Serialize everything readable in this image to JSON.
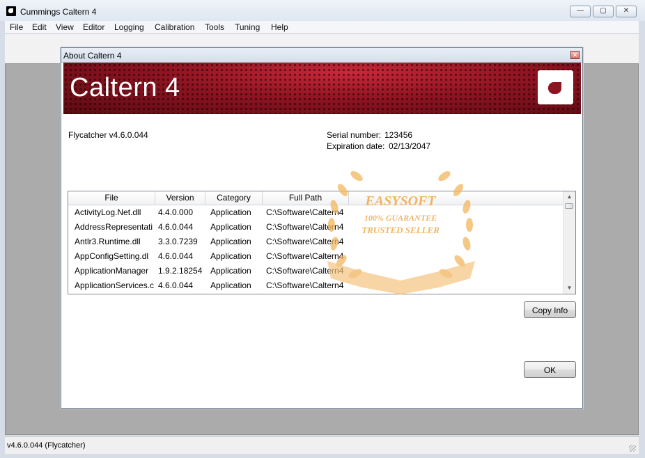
{
  "window": {
    "title": "Cummings Caltern 4",
    "minimize_glyph": "—",
    "maximize_glyph": "▢",
    "close_glyph": "✕"
  },
  "menu": [
    "File",
    "Edit",
    "View",
    "Editor",
    "Logging",
    "Calibration",
    "Tools",
    "Tuning",
    "Help"
  ],
  "dialog": {
    "title": "About Caltern 4",
    "close_glyph": "✕",
    "banner_title": "Caltern 4",
    "product_version": "Flycatcher v4.6.0.044",
    "serial_label": "Serial number:",
    "serial_value": "123456",
    "expiration_label": "Expiration date:",
    "expiration_value": "02/13/2047",
    "columns": [
      "File",
      "Version",
      "Category",
      "Full Path"
    ],
    "rows": [
      [
        "ActivityLog.Net.dll",
        "4.4.0.000",
        "Application",
        "C:\\Software\\Caltern4"
      ],
      [
        "AddressRepresentati",
        "4.6.0.044",
        "Application",
        "C:\\Software\\Caltern4"
      ],
      [
        "Antlr3.Runtime.dll",
        "3.3.0.7239",
        "Application",
        "C:\\Software\\Caltern4"
      ],
      [
        "AppConfigSetting.dl",
        "4.6.0.044",
        "Application",
        "C:\\Software\\Caltern4"
      ],
      [
        "ApplicationManager",
        "1.9.2.18254",
        "Application",
        "C:\\Software\\Caltern4"
      ],
      [
        "ApplicationServices.c",
        "4.6.0.044",
        "Application",
        "C:\\Software\\Caltern4"
      ]
    ],
    "copy_info_label": "Copy Info",
    "ok_label": "OK"
  },
  "watermark": {
    "line1": "EASYSOFT",
    "line2": "100% GUARANTEE",
    "line3": "TRUSTED SELLER"
  },
  "status": {
    "text": "v4.6.0.044 (Flycatcher)"
  },
  "colors": {
    "banner_red": "#8e1421",
    "watermark_gold": "#efae53"
  }
}
